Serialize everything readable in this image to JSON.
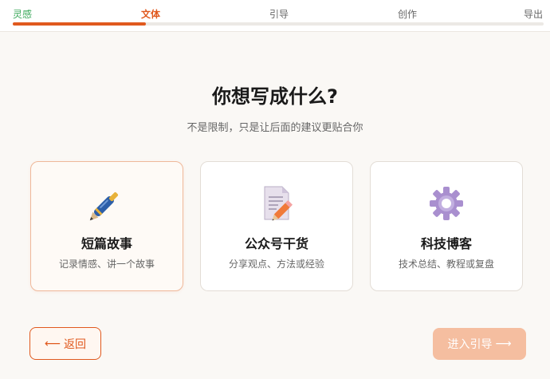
{
  "steps": [
    {
      "label": "灵感",
      "state": "done"
    },
    {
      "label": "文体",
      "state": "active"
    },
    {
      "label": "引导",
      "state": "pending"
    },
    {
      "label": "创作",
      "state": "pending"
    },
    {
      "label": "导出",
      "state": "pending"
    }
  ],
  "progress": 0.25,
  "heading": "你想写成什么?",
  "subheading": "不是限制，只是让后面的建议更贴合你",
  "cards": [
    {
      "icon": "pen-icon",
      "title": "短篇故事",
      "desc": "记录情感、讲一个故事",
      "selected": true
    },
    {
      "icon": "document-edit-icon",
      "title": "公众号干货",
      "desc": "分享观点、方法或经验",
      "selected": false
    },
    {
      "icon": "gear-icon",
      "title": "科技博客",
      "desc": "技术总结、教程或复盘",
      "selected": false
    }
  ],
  "nav": {
    "back_label": "返回",
    "back_arrow": "⟵",
    "next_label": "进入引导",
    "next_arrow": "⟶"
  },
  "colors": {
    "accent": "#e0591e",
    "done": "#3aa85a",
    "next_disabled": "#f5bea0"
  }
}
